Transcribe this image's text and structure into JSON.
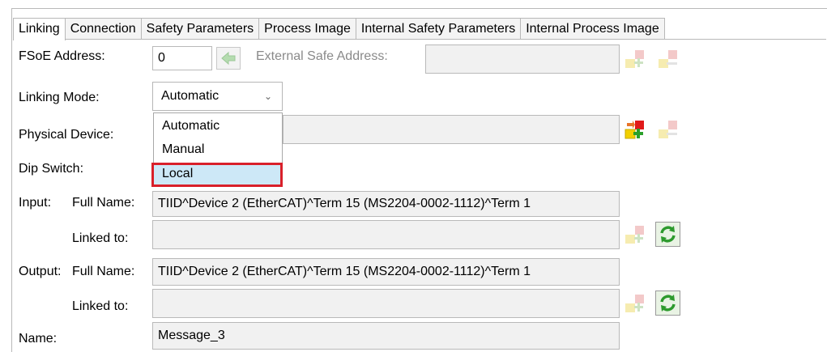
{
  "tabs": [
    {
      "label": "Linking",
      "active": true
    },
    {
      "label": "Connection",
      "active": false
    },
    {
      "label": "Safety Parameters",
      "active": false
    },
    {
      "label": "Process Image",
      "active": false
    },
    {
      "label": "Internal Safety Parameters",
      "active": false
    },
    {
      "label": "Internal Process Image",
      "active": false
    }
  ],
  "fsoe": {
    "label": "FSoE Address:",
    "value": "0",
    "external_label": "External Safe Address:",
    "external_value": ""
  },
  "linking_mode": {
    "label": "Linking Mode:",
    "value": "Automatic",
    "options": [
      "Automatic",
      "Manual",
      "Local"
    ],
    "highlighted": "Local"
  },
  "physical_device": {
    "label": "Physical Device:",
    "value": ""
  },
  "dip_switch": {
    "label": "Dip Switch:"
  },
  "input": {
    "label": "Input:",
    "full_name_label": "Full Name:",
    "full_name": "TIID^Device 2 (EtherCAT)^Term 15 (MS2204-0002-1112)^Term 1",
    "linked_label": "Linked to:",
    "linked_value": ""
  },
  "output": {
    "label": "Output:",
    "full_name_label": "Full Name:",
    "full_name": "TIID^Device 2 (EtherCAT)^Term 15 (MS2204-0002-1112)^Term 1",
    "linked_label": "Linked to:",
    "linked_value": ""
  },
  "name": {
    "label": "Name:",
    "value": "Message_3"
  },
  "colors": {
    "highlight": "#cde8f7",
    "selection_border": "#d9202a",
    "field_bg": "#f1f1f1"
  }
}
